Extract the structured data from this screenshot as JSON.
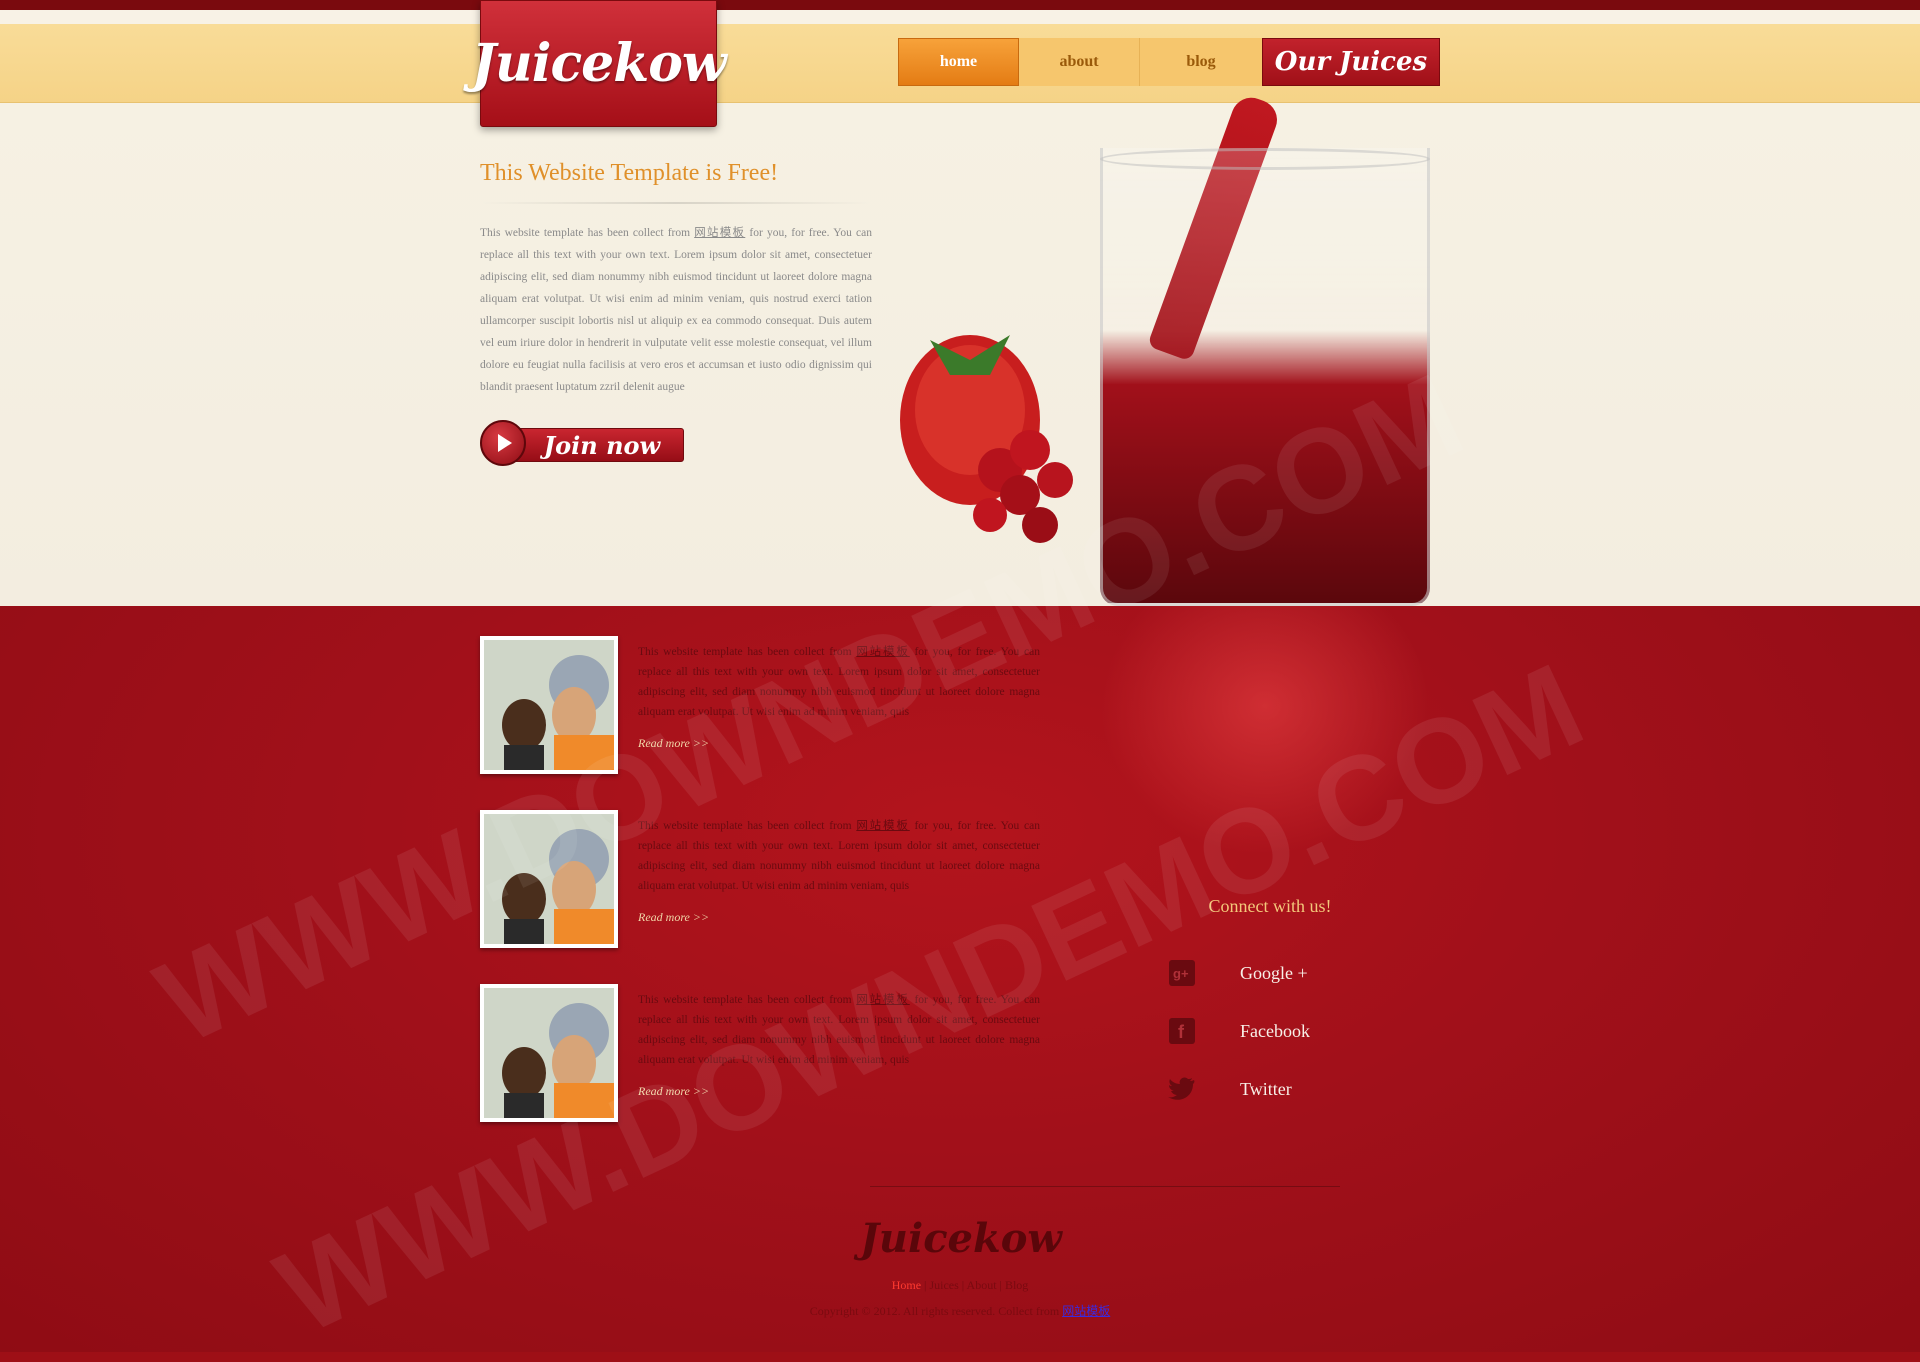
{
  "brand": {
    "logo_text": "Juicekow",
    "footer_logo_text": "Juicekow"
  },
  "nav": {
    "items": [
      {
        "label": "home",
        "active": true
      },
      {
        "label": "about",
        "active": false
      },
      {
        "label": "blog",
        "active": false
      },
      {
        "label": "Our Juices",
        "active": false
      }
    ]
  },
  "hero": {
    "title": "This Website Template is Free!",
    "text_before_link": "This website template has been collect from ",
    "link_text": "网站模板",
    "text_after_link": " for you, for free. You can replace all this text with your own text. Lorem ipsum dolor sit amet, consectetuer adipiscing elit, sed diam nonummy nibh euismod tincidunt ut laoreet dolore magna aliquam erat volutpat. Ut wisi enim ad minim veniam, quis nostrud exerci tation ullamcorper suscipit lobortis nisl ut aliquip ex ea commodo consequat. Duis autem vel eum iriure dolor in hendrerit in vulputate velit esse molestie consequat, vel illum dolore eu feugiat nulla facilisis at vero eros et accumsan et iusto odio dignissim qui blandit praesent luptatum zzril delenit augue",
    "cta_label": "Join now"
  },
  "posts": [
    {
      "text_before_link": "This website template has been collect from ",
      "link_text": "网站模板",
      "text_after_link": " for you, for free. You can replace all this text with your own text. Lorem ipsum dolor sit amet, consectetuer adipiscing elit, sed diam nonummy nibh euismod tincidunt ut laoreet dolore magna aliquam erat volutpat. Ut wisi enim ad minim veniam, quis",
      "read_more": "Read more >>"
    },
    {
      "text_before_link": "This website template has been collect from ",
      "link_text": "网站模板",
      "text_after_link": " for you, for free. You can replace all this text with your own text. Lorem ipsum dolor sit amet, consectetuer adipiscing elit, sed diam nonummy nibh euismod tincidunt ut laoreet dolore magna aliquam erat volutpat. Ut wisi enim ad minim veniam, quis",
      "read_more": "Read more >>"
    },
    {
      "text_before_link": "This website template has been collect from ",
      "link_text": "网站模板",
      "text_after_link": " for you, for free. You can replace all this text with your own text. Lorem ipsum dolor sit amet, consectetuer adipiscing elit, sed diam nonummy nibh euismod tincidunt ut laoreet dolore magna aliquam erat volutpat. Ut wisi enim ad minim veniam, quis",
      "read_more": "Read more >>"
    }
  ],
  "connect": {
    "title": "Connect with us!",
    "items": [
      {
        "label": "Google +",
        "icon": "google-plus-icon"
      },
      {
        "label": "Facebook",
        "icon": "facebook-icon"
      },
      {
        "label": "Twitter",
        "icon": "twitter-icon"
      }
    ]
  },
  "footer": {
    "links": [
      "Home",
      "Juices",
      "About",
      "Blog"
    ],
    "copyright_text": "Copyright © 2012. All rights reserved. Collect from",
    "copyright_link": "网站模板"
  },
  "watermark_text": "WWW.DOWNDEMO.COM",
  "colors": {
    "primary_red": "#a1101a",
    "header_cream": "#f8dd9a",
    "nav_orange": "#e47c14",
    "hero_title": "#e0902a",
    "connect_title": "#f3c77a"
  }
}
